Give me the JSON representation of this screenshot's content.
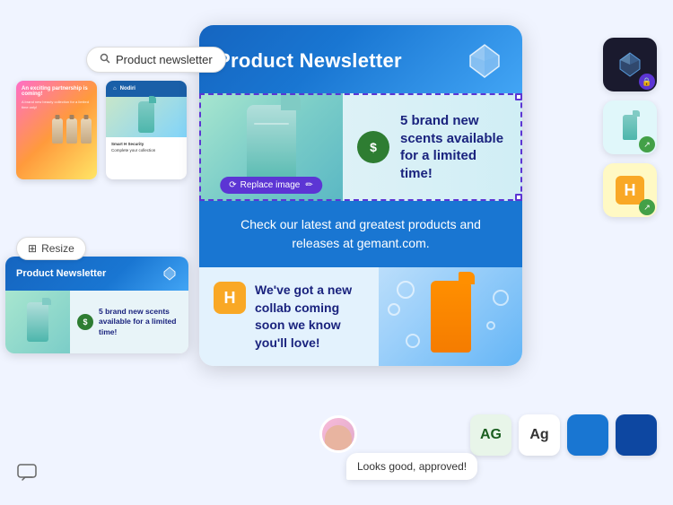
{
  "search": {
    "placeholder": "Product newsletter",
    "value": "Product newsletter"
  },
  "resize_btn": "Resize",
  "main_newsletter": {
    "title": "Product Newsletter",
    "section1_text": "5 brand new scents available for a limited time!",
    "section2_text": "Check our latest and greatest products and releases at gemant.com.",
    "section3_text": "We've got a new collab coming soon we know you'll love!",
    "replace_image_btn": "Replace image"
  },
  "chat": {
    "message": "Looks good, approved!"
  },
  "preview_card": {
    "title": "Product Newsletter",
    "scent_text": "5 brand new scents available for a limited time!"
  },
  "icons": {
    "search": "🔍",
    "gem": "◈",
    "lock": "🔒",
    "share": "↗",
    "comment": "💬",
    "resize": "⊞",
    "replace": "⟳",
    "ag1": "AG",
    "ag2": "Ag",
    "dollar": "$",
    "H": "H"
  }
}
